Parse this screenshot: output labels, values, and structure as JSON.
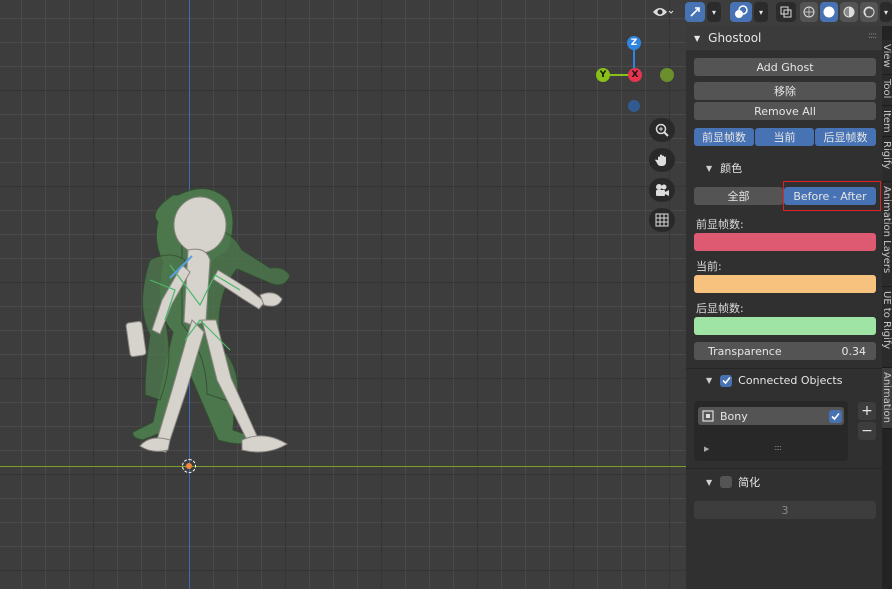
{
  "panel": {
    "title": "Ghostool",
    "add_ghost": "Add Ghost",
    "remove": "移除",
    "remove_all": "Remove All",
    "frame_buttons": [
      "前显帧数",
      "当前",
      "后显帧数"
    ]
  },
  "color_section": {
    "header": "颜色",
    "modes": [
      "全部",
      "Before - After"
    ],
    "active_mode": "Before - After",
    "before_label": "前显帧数:",
    "before_color": "#de5a72",
    "current_label": "当前:",
    "current_color": "#f7c27e",
    "after_label": "后显帧数:",
    "after_color": "#9fe3a5",
    "transparence_label": "Transparence",
    "transparence_value": "0.34"
  },
  "connected": {
    "header": "Connected Objects",
    "checked": true,
    "items": [
      {
        "name": "Bony",
        "checked": true
      }
    ],
    "resize_handle": "::::"
  },
  "simplify": {
    "header": "简化",
    "checked": false,
    "value": "3"
  },
  "gizmo": {
    "z": "Z",
    "y": "Y",
    "x": "X"
  },
  "tabs": [
    "Animation",
    "UE to Rigify",
    "Animation Layers",
    "Rigify",
    "Item",
    "Tool",
    "View"
  ],
  "icons": [
    "eye-icon",
    "pose-icon",
    "overlay-icon",
    "xray-icon",
    "wireframe-icon",
    "solid-icon",
    "material-icon",
    "rendered-icon",
    "zoom-icon",
    "hand-icon",
    "camera-icon",
    "grid-icon"
  ],
  "colors": {
    "accent": "#4772b3",
    "highlight_box": "#e0202a",
    "x_axis": "#e8344f",
    "y_axis": "#89c01a",
    "z_axis": "#2f84e0"
  }
}
